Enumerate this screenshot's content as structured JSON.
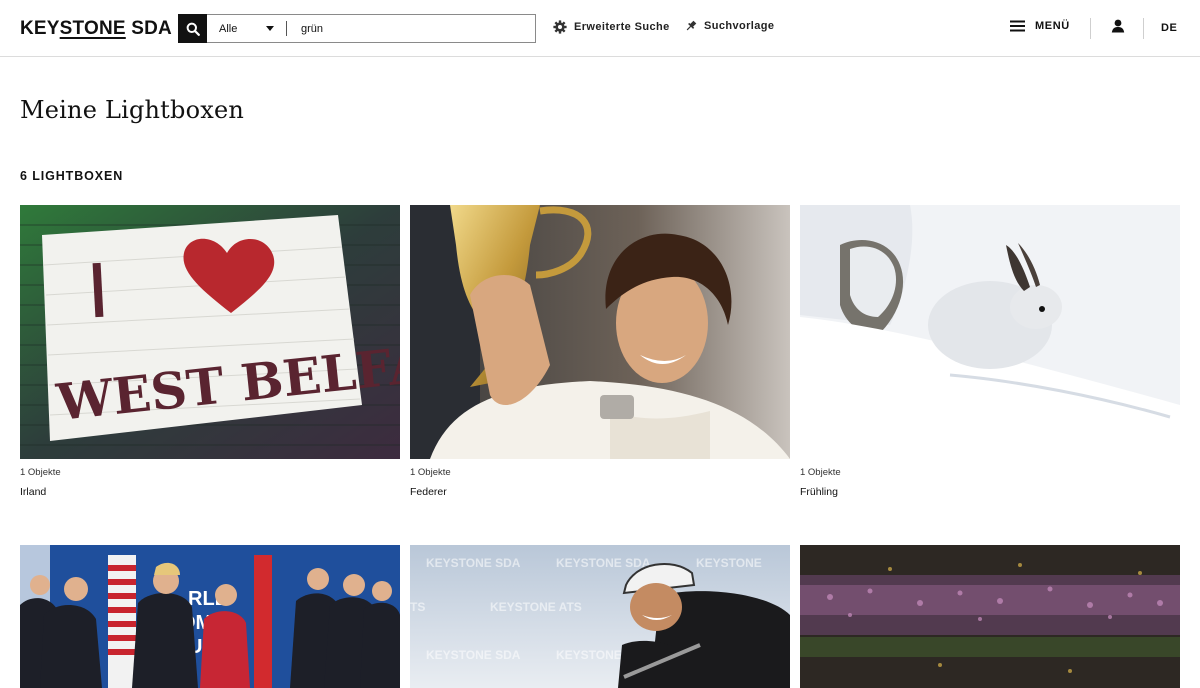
{
  "header": {
    "logo_a": "KEY",
    "logo_b": "STONE",
    "logo_c": " SDA",
    "search": {
      "scope_value": "Alle",
      "query": "grün"
    },
    "advanced_search_label": "Erweiterte Suche",
    "search_template_label": "Suchvorlage",
    "menu_label": "MENÜ",
    "language": "DE"
  },
  "main": {
    "title": "Meine Lightboxen",
    "count_label": "6 LIGHTBOXEN",
    "lightboxes": [
      {
        "objects": "1 Objekte",
        "name": "Irland",
        "image_text": "I WEST BELFAST"
      },
      {
        "objects": "1 Objekte",
        "name": "Federer"
      },
      {
        "objects": "1 Objekte",
        "name": "Frühling"
      },
      {
        "image_text": "RLD OMIC UM"
      },
      {
        "image_text": [
          "KEYSTONE SDA",
          "KEYSTONE ATS",
          "TS"
        ]
      },
      {}
    ]
  },
  "colors": {
    "accent": "#111111",
    "divider": "#dcdcdc",
    "heart": "#b8282e"
  },
  "icons": [
    "search-icon",
    "chevron-down-icon",
    "gear-icon",
    "pin-icon",
    "hamburger-menu-icon",
    "user-icon"
  ]
}
